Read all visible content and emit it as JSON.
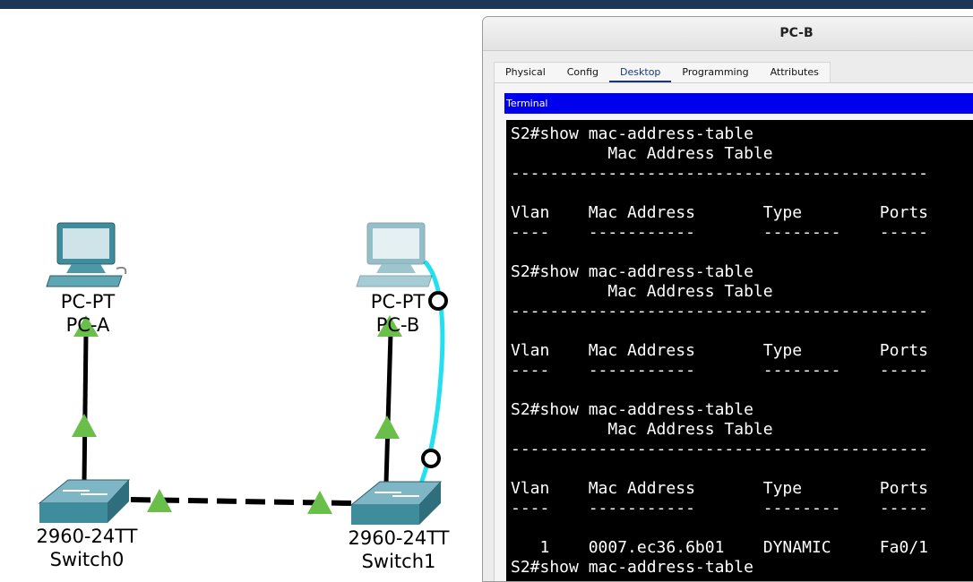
{
  "window": {
    "title": "PC-B"
  },
  "tabs": [
    {
      "label": "Physical",
      "active": false
    },
    {
      "label": "Config",
      "active": false
    },
    {
      "label": "Desktop",
      "active": true
    },
    {
      "label": "Programming",
      "active": false
    },
    {
      "label": "Attributes",
      "active": false
    }
  ],
  "terminal": {
    "title": "Terminal",
    "lines": [
      "S2#show mac-address-table",
      "          Mac Address Table",
      "-------------------------------------------",
      "",
      "Vlan    Mac Address       Type        Ports",
      "----    -----------       --------    -----",
      "",
      "S2#show mac-address-table",
      "          Mac Address Table",
      "-------------------------------------------",
      "",
      "Vlan    Mac Address       Type        Ports",
      "----    -----------       --------    -----",
      "",
      "S2#show mac-address-table",
      "          Mac Address Table",
      "-------------------------------------------",
      "",
      "Vlan    Mac Address       Type        Ports",
      "----    -----------       --------    -----",
      "",
      "   1    0007.ec36.6b01    DYNAMIC     Fa0/1",
      "S2#show mac-address-table"
    ]
  },
  "topology": {
    "devices": [
      {
        "model": "PC-PT",
        "name": "PC-A"
      },
      {
        "model": "PC-PT",
        "name": "PC-B"
      },
      {
        "model": "2960-24TT",
        "name": "Switch0"
      },
      {
        "model": "2960-24TT",
        "name": "Switch1"
      }
    ],
    "colors": {
      "link_up": "#6abf4b",
      "console_cable": "#22e0f0",
      "link": "#000000"
    }
  }
}
